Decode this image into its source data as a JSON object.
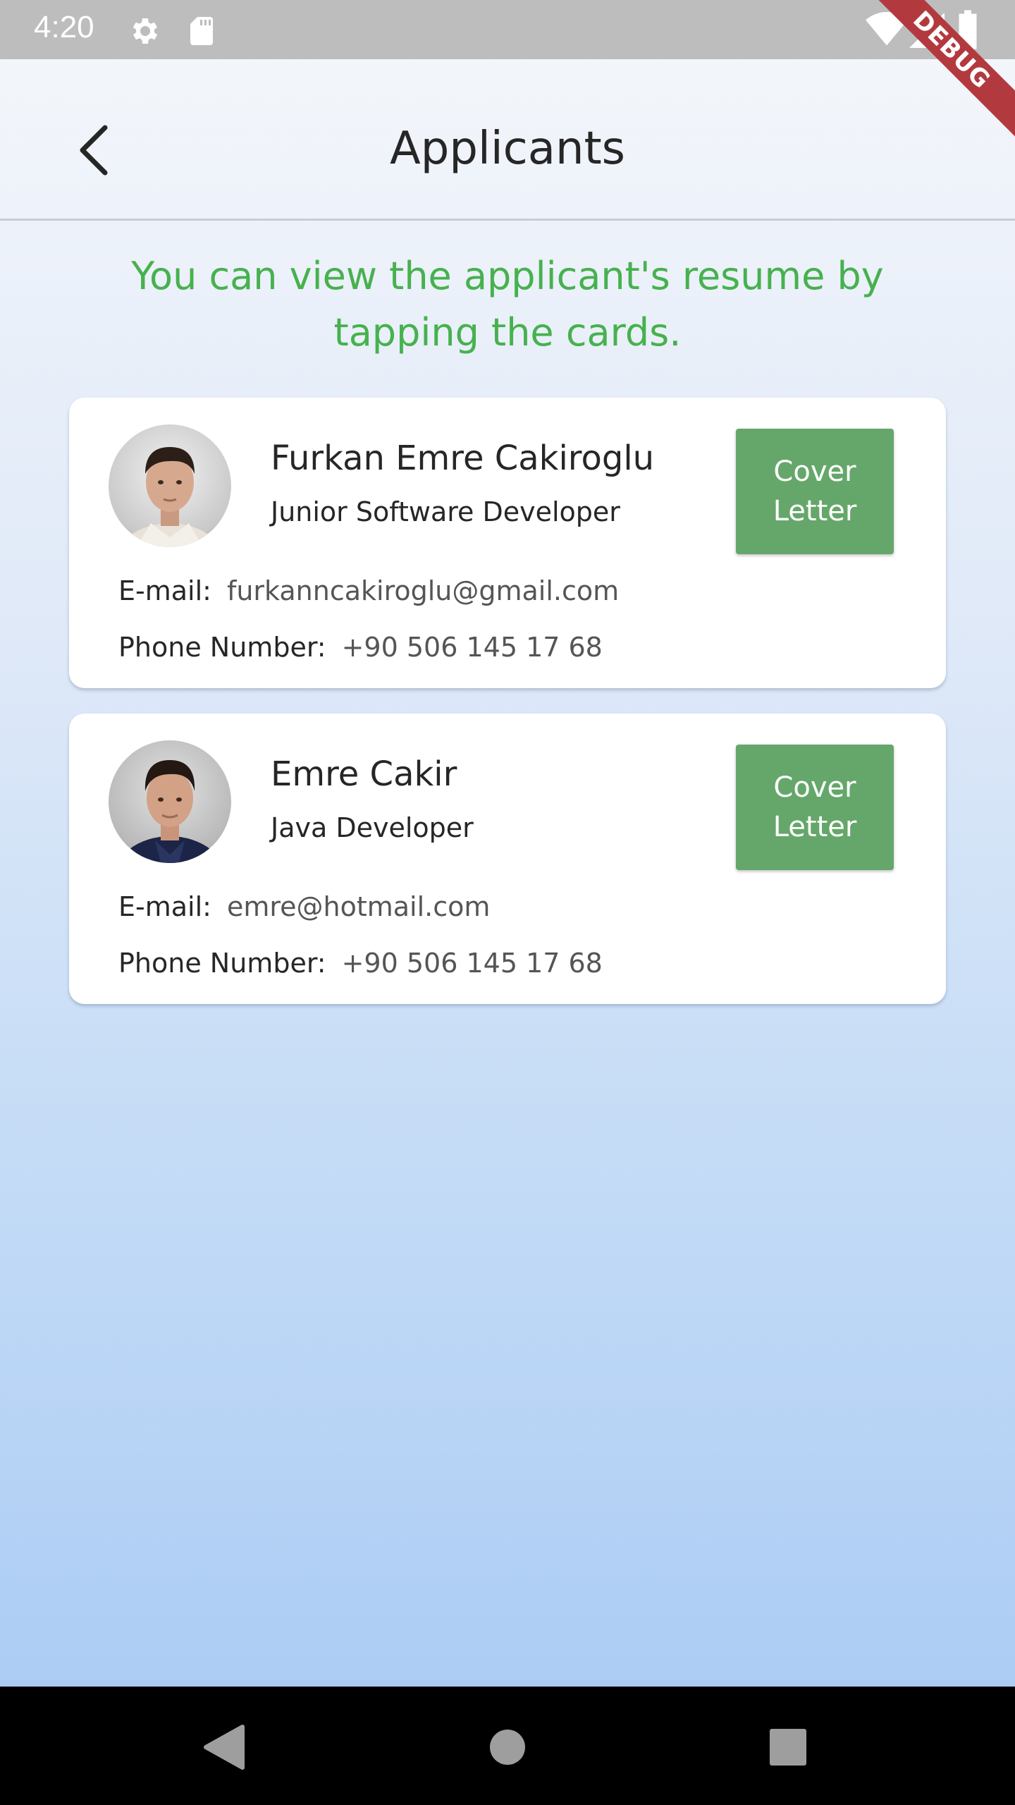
{
  "status_bar": {
    "time": "4:20",
    "icons": [
      "gear-icon",
      "sd-card-icon",
      "wifi-icon",
      "signal-icon",
      "battery-icon"
    ]
  },
  "debug_banner": "DEBUG",
  "app_bar": {
    "title": "Applicants",
    "back_icon": "chevron-left-icon"
  },
  "hint": "You can view the applicant's resume by tapping the cards.",
  "labels": {
    "email": "E-mail:",
    "phone": "Phone Number:"
  },
  "applicants": [
    {
      "name": "Furkan Emre Cakiroglu",
      "role": "Junior Software Developer",
      "email": "furkanncakiroglu@gmail.com",
      "phone": "+90 506 145 17 68",
      "cover_line1": "Cover",
      "cover_line2": "Letter"
    },
    {
      "name": "Emre Cakir",
      "role": "Java Developer",
      "email": "emre@hotmail.com",
      "phone": "+90 506 145 17 68",
      "cover_line1": "Cover",
      "cover_line2": "Letter"
    }
  ],
  "colors": {
    "accent_green": "#47b14e",
    "button_green": "#65a76a",
    "status_bar": "#bdbdbd",
    "debug_red": "#b23a3f"
  },
  "nav_bar": {
    "icons": [
      "nav-back-icon",
      "nav-home-icon",
      "nav-recents-icon"
    ]
  }
}
